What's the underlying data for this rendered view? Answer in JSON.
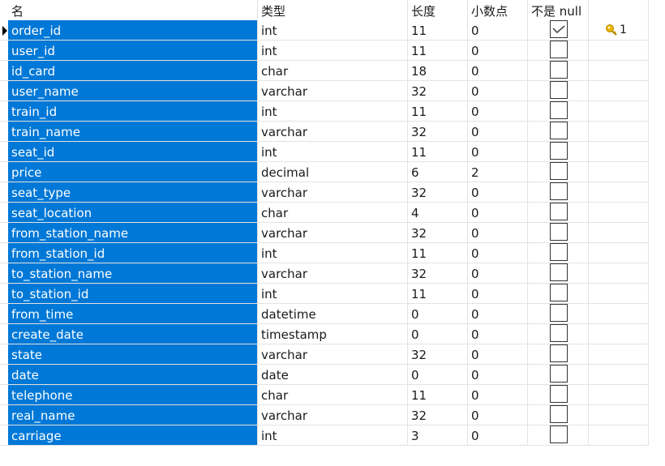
{
  "headers": {
    "name": "名",
    "type": "类型",
    "length": "长度",
    "decimals": "小数点",
    "not_null": "不是 null"
  },
  "rows": [
    {
      "name": "order_id",
      "type": "int",
      "length": "11",
      "decimals": "0",
      "not_null": true,
      "key": "1"
    },
    {
      "name": "user_id",
      "type": "int",
      "length": "11",
      "decimals": "0",
      "not_null": false
    },
    {
      "name": "id_card",
      "type": "char",
      "length": "18",
      "decimals": "0",
      "not_null": false
    },
    {
      "name": "user_name",
      "type": "varchar",
      "length": "32",
      "decimals": "0",
      "not_null": false
    },
    {
      "name": "train_id",
      "type": "int",
      "length": "11",
      "decimals": "0",
      "not_null": false
    },
    {
      "name": "train_name",
      "type": "varchar",
      "length": "32",
      "decimals": "0",
      "not_null": false
    },
    {
      "name": "seat_id",
      "type": "int",
      "length": "11",
      "decimals": "0",
      "not_null": false
    },
    {
      "name": "price",
      "type": "decimal",
      "length": "6",
      "decimals": "2",
      "not_null": false
    },
    {
      "name": "seat_type",
      "type": "varchar",
      "length": "32",
      "decimals": "0",
      "not_null": false
    },
    {
      "name": "seat_location",
      "type": "char",
      "length": "4",
      "decimals": "0",
      "not_null": false
    },
    {
      "name": "from_station_name",
      "type": "varchar",
      "length": "32",
      "decimals": "0",
      "not_null": false
    },
    {
      "name": "from_station_id",
      "type": "int",
      "length": "11",
      "decimals": "0",
      "not_null": false
    },
    {
      "name": "to_station_name",
      "type": "varchar",
      "length": "32",
      "decimals": "0",
      "not_null": false
    },
    {
      "name": "to_station_id",
      "type": "int",
      "length": "11",
      "decimals": "0",
      "not_null": false
    },
    {
      "name": "from_time",
      "type": "datetime",
      "length": "0",
      "decimals": "0",
      "not_null": false
    },
    {
      "name": "create_date",
      "type": "timestamp",
      "length": "0",
      "decimals": "0",
      "not_null": false
    },
    {
      "name": "state",
      "type": "varchar",
      "length": "32",
      "decimals": "0",
      "not_null": false
    },
    {
      "name": "date",
      "type": "date",
      "length": "0",
      "decimals": "0",
      "not_null": false
    },
    {
      "name": "telephone",
      "type": "char",
      "length": "11",
      "decimals": "0",
      "not_null": false
    },
    {
      "name": "real_name",
      "type": "varchar",
      "length": "32",
      "decimals": "0",
      "not_null": false
    },
    {
      "name": "carriage",
      "type": "int",
      "length": "3",
      "decimals": "0",
      "not_null": false
    }
  ],
  "colors": {
    "selection": "#0078d7",
    "key_icon": "#e8b400"
  },
  "icons": {
    "row_indicator": "current-row-arrow-icon",
    "primary_key": "key-icon"
  }
}
